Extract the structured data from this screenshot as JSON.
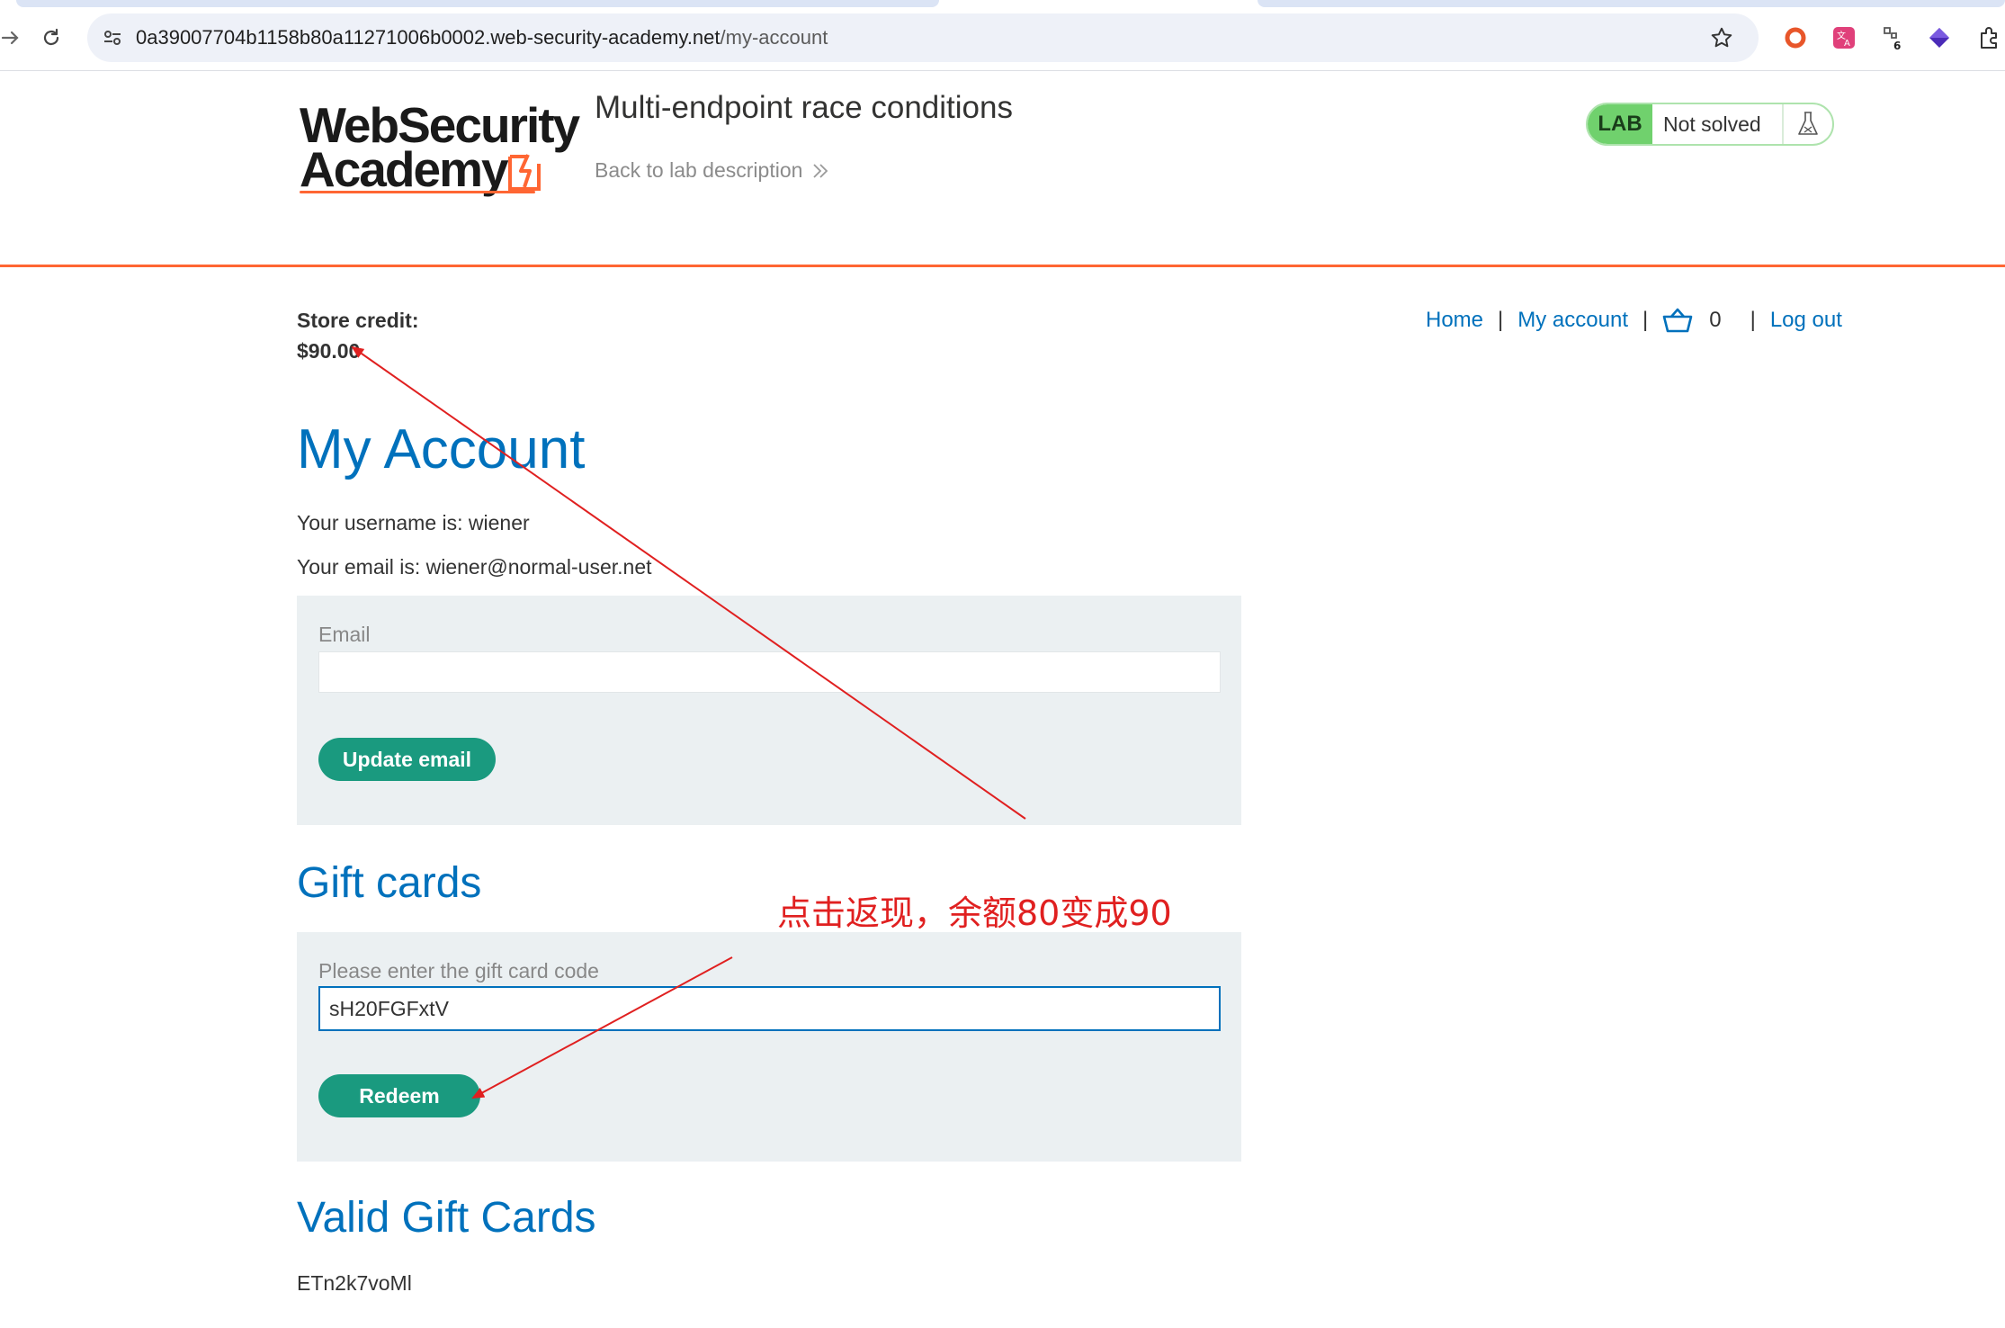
{
  "browser": {
    "url_host": "0a39007704b1158b80a11271006b0002.web-security-academy.net",
    "url_path": "/my-account",
    "extension_badge": "6"
  },
  "lab": {
    "logo_line1": "WebSecurity",
    "logo_line2": "Academy",
    "title": "Multi-endpoint race conditions",
    "back_link": "Back to lab description",
    "badge": "LAB",
    "status": "Not solved"
  },
  "store": {
    "credit_label": "Store credit:",
    "credit_value": "$90.00"
  },
  "nav": {
    "home": "Home",
    "my_account": "My account",
    "cart_count": "0",
    "log_out": "Log out",
    "separator": "|"
  },
  "account": {
    "heading": "My Account",
    "username_line": "Your username is: wiener",
    "email_line": "Your email is: wiener@normal-user.net",
    "email_label": "Email",
    "email_value": "",
    "update_button": "Update email"
  },
  "gift": {
    "heading": "Gift cards",
    "code_label": "Please enter the gift card code",
    "code_value": "sH20FGFxtV",
    "redeem_button": "Redeem"
  },
  "valid_cards": {
    "heading": "Valid Gift Cards",
    "codes": [
      "ETn2k7voMl"
    ]
  },
  "annotation": {
    "text": "点击返现，余额80变成90",
    "color": "#e02020"
  },
  "colors": {
    "brand_orange": "#ff6633",
    "link_blue": "#0071bc",
    "button_green": "#1a9a7f",
    "lab_green": "#70d16d"
  }
}
